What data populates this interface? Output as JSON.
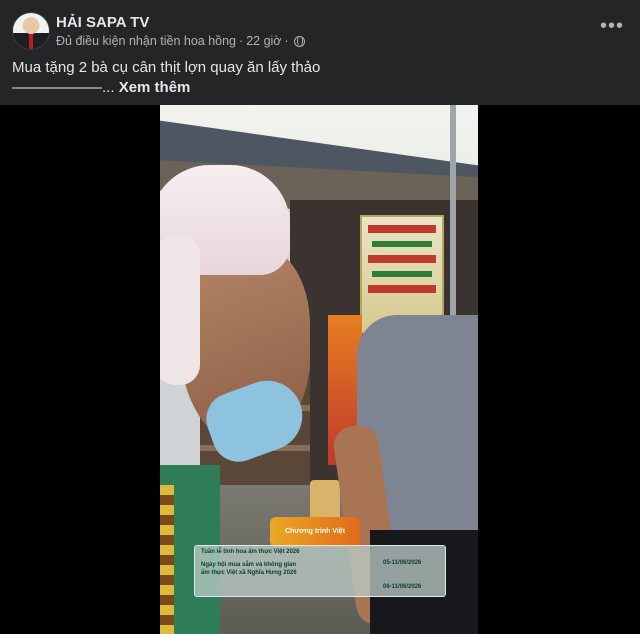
{
  "post": {
    "author": "HẢI SAPA TV",
    "subtitle": "Đủ điều kiện nhận tiền hoa hồng",
    "time": "22 giờ",
    "more_icon": "more-horizontal-icon",
    "privacy_icon": "globe-icon",
    "text_line1": "Mua tặng 2 bà cụ cân thịt lợn quay ăn lấy thảo",
    "text_line2": "——————...",
    "see_more": "Xem thêm"
  },
  "video": {
    "badge": "Chương trình Việt",
    "overlay": {
      "line1": "Tuần lễ tinh hoa ẩm thực Việt 2026",
      "line2": "Ngày hội mua sắm và không gian",
      "line3": "ẩm thực Việt xã Nghĩa Hưng 2026",
      "date1": "05-11/06/2026",
      "date2": "06-11/06/2026"
    }
  },
  "colors": {
    "background": "#242526",
    "text_primary": "#e4e6eb",
    "text_secondary": "#b0b3b8",
    "video_bg": "#000000"
  }
}
